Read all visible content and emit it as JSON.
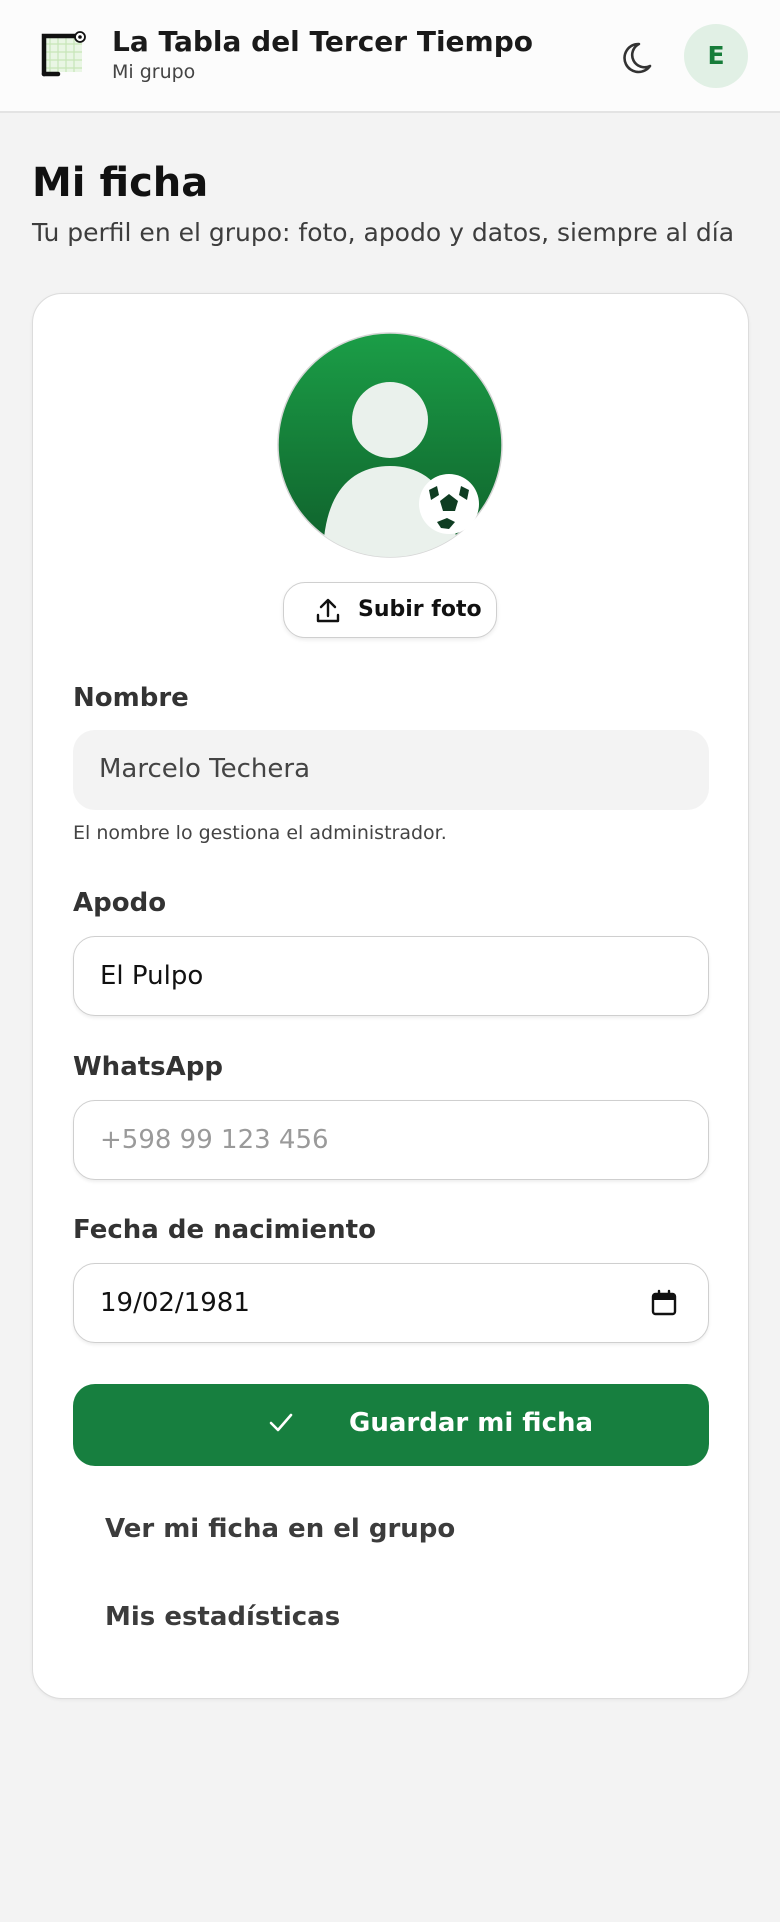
{
  "header": {
    "app_title": "La Tabla del Tercer Tiempo",
    "group": "Mi grupo",
    "user_initial": "E",
    "logo_icon": "goal-net-icon",
    "theme_icon": "moon-icon"
  },
  "page": {
    "title": "Mi ficha",
    "subtitle": "Tu perfil en el grupo: foto, apodo y datos, siempre al día"
  },
  "profile": {
    "photo_icon": "user-silhouette-icon",
    "badge_icon": "soccer-ball-icon",
    "upload_label": "Subir foto",
    "upload_icon": "upload-icon"
  },
  "form": {
    "nombre": {
      "label": "Nombre",
      "value": "Marcelo Techera",
      "help": "El nombre lo gestiona el administrador."
    },
    "apodo": {
      "label": "Apodo",
      "value": "El Pulpo"
    },
    "whatsapp": {
      "label": "WhatsApp",
      "value": "",
      "placeholder": "+598 99 123 456"
    },
    "nacimiento": {
      "label": "Fecha de nacimiento",
      "value": "19/02/1981"
    },
    "save_label": "Guardar mi ficha"
  },
  "links": {
    "ver_ficha": "Ver mi ficha en el grupo",
    "estadisticas": "Mis estadísticas"
  },
  "colors": {
    "accent": "#177f3f",
    "avatar_bg": "#e1f0e5",
    "avatar_text": "#177d3a",
    "page_bg": "#f3f3f3"
  }
}
